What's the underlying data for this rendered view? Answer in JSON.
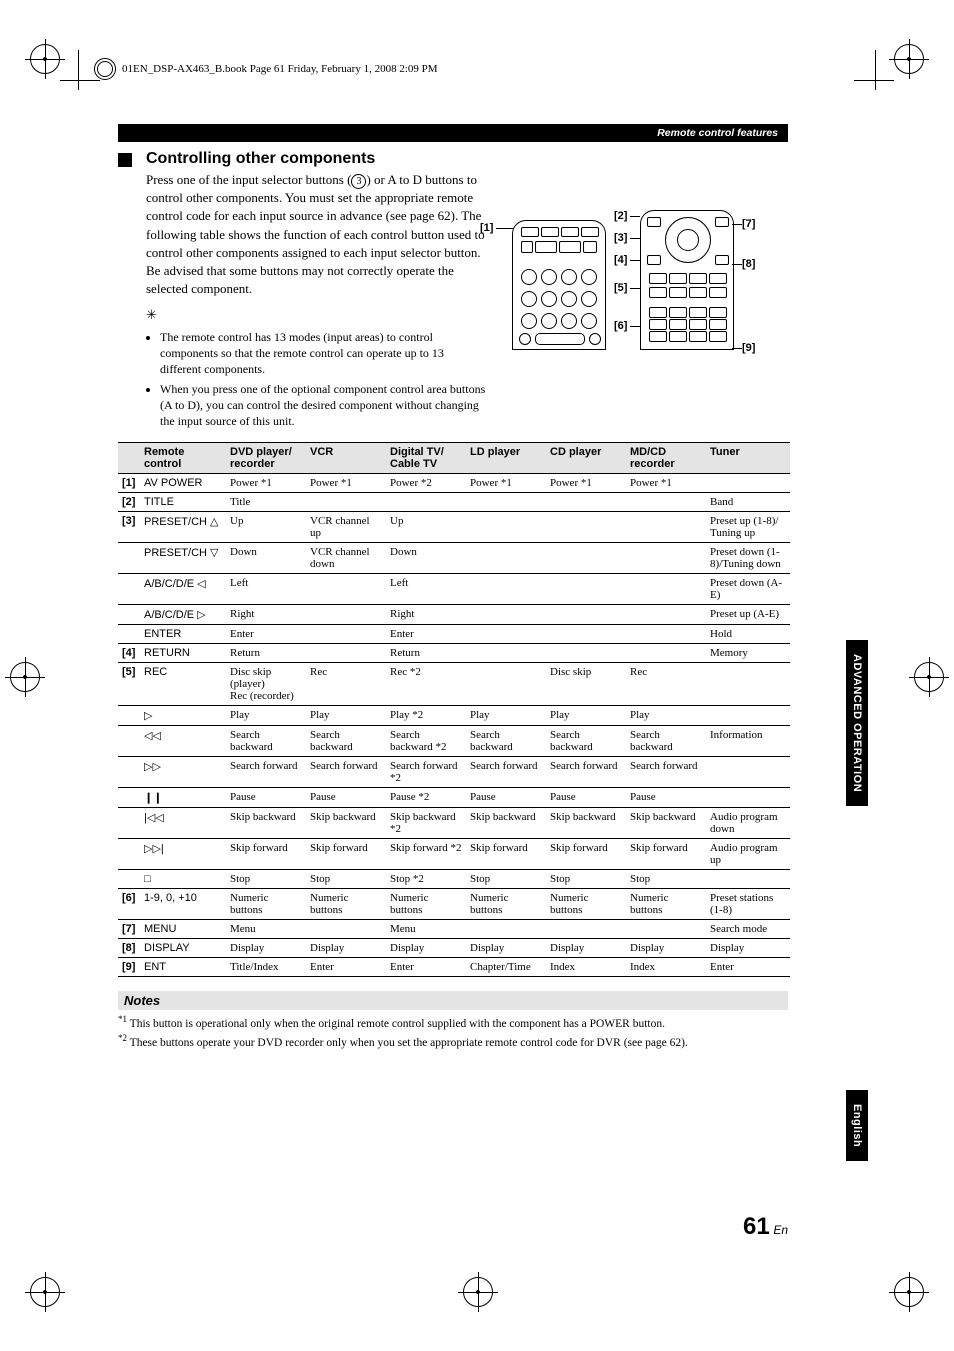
{
  "meta": {
    "topline": "01EN_DSP-AX463_B.book  Page 61  Friday, February 1, 2008  2:09 PM"
  },
  "header": {
    "running": "Remote control features"
  },
  "section": {
    "title": "Controlling other components",
    "para1a": "Press one of the input selector buttons (",
    "circled": "3",
    "para1b": ") or A to D buttons to control other components. You must set the appropriate remote control code for each input source in advance (see page 62). The following table shows the function of each control button used to control other components assigned to each input selector button. Be advised that some buttons may not correctly operate the selected component.",
    "bullet1": "The remote control has 13 modes (input areas) to control components so that the remote control can operate up to 13 different components.",
    "bullet2": "When you press one of the optional component control area buttons (A to D), you can control the desired component without changing the input source of this unit."
  },
  "diagram_labels": [
    "1",
    "2",
    "3",
    "4",
    "5",
    "6",
    "7",
    "8",
    "9"
  ],
  "table": {
    "headers": {
      "rc": "Remote control",
      "dvd": "DVD player/\nrecorder",
      "vcr": "VCR",
      "dtv": "Digital TV/\nCable TV",
      "ld": "LD player",
      "cd": "CD player",
      "md": "MD/CD\nrecorder",
      "tuner": "Tuner"
    },
    "rows": [
      {
        "ref": "[1]",
        "rc": "AV POWER",
        "dvd": "Power *1",
        "vcr": "Power *1",
        "dtv": "Power *2",
        "ld": "Power *1",
        "cd": "Power *1",
        "md": "Power *1",
        "tuner": ""
      },
      {
        "ref": "[2]",
        "rc": "TITLE",
        "dvd": "Title",
        "vcr": "",
        "dtv": "",
        "ld": "",
        "cd": "",
        "md": "",
        "tuner": "Band"
      },
      {
        "ref": "[3]",
        "rc": "PRESET/CH △",
        "dvd": "Up",
        "vcr": "VCR channel up",
        "dtv": "Up",
        "ld": "",
        "cd": "",
        "md": "",
        "tuner": "Preset up (1-8)/\nTuning up"
      },
      {
        "ref": "",
        "rc": "PRESET/CH ▽",
        "dvd": "Down",
        "vcr": "VCR channel down",
        "dtv": "Down",
        "ld": "",
        "cd": "",
        "md": "",
        "tuner": "Preset down (1-8)/Tuning down"
      },
      {
        "ref": "",
        "rc": "A/B/C/D/E ◁",
        "dvd": "Left",
        "vcr": "",
        "dtv": "Left",
        "ld": "",
        "cd": "",
        "md": "",
        "tuner": "Preset down (A-E)"
      },
      {
        "ref": "",
        "rc": "A/B/C/D/E ▷",
        "dvd": "Right",
        "vcr": "",
        "dtv": "Right",
        "ld": "",
        "cd": "",
        "md": "",
        "tuner": "Preset up (A-E)"
      },
      {
        "ref": "",
        "rc": "ENTER",
        "dvd": "Enter",
        "vcr": "",
        "dtv": "Enter",
        "ld": "",
        "cd": "",
        "md": "",
        "tuner": "Hold"
      },
      {
        "ref": "[4]",
        "rc": "RETURN",
        "dvd": "Return",
        "vcr": "",
        "dtv": "Return",
        "ld": "",
        "cd": "",
        "md": "",
        "tuner": "Memory"
      },
      {
        "ref": "[5]",
        "rc": "REC",
        "dvd": "Disc skip (player)\nRec (recorder)",
        "vcr": "Rec",
        "dtv": "Rec *2",
        "ld": "",
        "cd": "Disc skip",
        "md": "Rec",
        "tuner": ""
      },
      {
        "ref": "",
        "rc": "▷",
        "dvd": "Play",
        "vcr": "Play",
        "dtv": "Play *2",
        "ld": "Play",
        "cd": "Play",
        "md": "Play",
        "tuner": ""
      },
      {
        "ref": "",
        "rc": "◁◁",
        "dvd": "Search backward",
        "vcr": "Search backward",
        "dtv": "Search backward *2",
        "ld": "Search backward",
        "cd": "Search backward",
        "md": "Search backward",
        "tuner": "Information"
      },
      {
        "ref": "",
        "rc": "▷▷",
        "dvd": "Search forward",
        "vcr": "Search forward",
        "dtv": "Search forward *2",
        "ld": "Search forward",
        "cd": "Search forward",
        "md": "Search forward",
        "tuner": ""
      },
      {
        "ref": "",
        "rc": "❙❙",
        "dvd": "Pause",
        "vcr": "Pause",
        "dtv": "Pause *2",
        "ld": "Pause",
        "cd": "Pause",
        "md": "Pause",
        "tuner": ""
      },
      {
        "ref": "",
        "rc": "|◁◁",
        "dvd": "Skip backward",
        "vcr": "Skip backward",
        "dtv": "Skip backward *2",
        "ld": "Skip backward",
        "cd": "Skip backward",
        "md": "Skip backward",
        "tuner": "Audio program down"
      },
      {
        "ref": "",
        "rc": "▷▷|",
        "dvd": "Skip forward",
        "vcr": "Skip forward",
        "dtv": "Skip forward *2",
        "ld": "Skip forward",
        "cd": "Skip forward",
        "md": "Skip forward",
        "tuner": "Audio program up"
      },
      {
        "ref": "",
        "rc": "□",
        "dvd": "Stop",
        "vcr": "Stop",
        "dtv": "Stop *2",
        "ld": "Stop",
        "cd": "Stop",
        "md": "Stop",
        "tuner": ""
      },
      {
        "ref": "[6]",
        "rc": "1-9, 0, +10",
        "dvd": "Numeric buttons",
        "vcr": "Numeric buttons",
        "dtv": "Numeric buttons",
        "ld": "Numeric buttons",
        "cd": "Numeric buttons",
        "md": "Numeric buttons",
        "tuner": "Preset stations (1-8)"
      },
      {
        "ref": "[7]",
        "rc": "MENU",
        "dvd": "Menu",
        "vcr": "",
        "dtv": "Menu",
        "ld": "",
        "cd": "",
        "md": "",
        "tuner": "Search mode"
      },
      {
        "ref": "[8]",
        "rc": "DISPLAY",
        "dvd": "Display",
        "vcr": "Display",
        "dtv": "Display",
        "ld": "Display",
        "cd": "Display",
        "md": "Display",
        "tuner": "Display"
      },
      {
        "ref": "[9]",
        "rc": "ENT",
        "dvd": "Title/Index",
        "vcr": "Enter",
        "dtv": "Enter",
        "ld": "Chapter/Time",
        "cd": "Index",
        "md": "Index",
        "tuner": "Enter"
      }
    ]
  },
  "notes": {
    "head": "Notes",
    "n1": "This button is operational only when the original remote control supplied with the component has a POWER button.",
    "n2": "These buttons operate your DVD recorder only when you set the appropriate remote control code for DVR (see page 62)."
  },
  "sidetabs": {
    "adv": "ADVANCED OPERATION",
    "eng": "English"
  },
  "pageno": {
    "big": "61",
    "suf": "En"
  }
}
